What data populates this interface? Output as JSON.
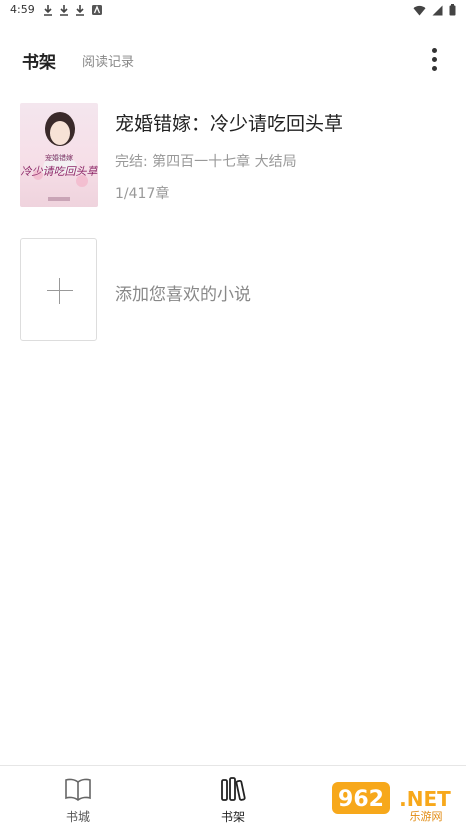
{
  "status_bar": {
    "time": "4:59"
  },
  "top_tabs": {
    "active": "书架",
    "inactive": "阅读记录"
  },
  "book": {
    "title": "宠婚错嫁：冷少请吃回头草",
    "status": "完结: 第四百一十七章  大结局",
    "progress": "1/417章",
    "cover_text": "冷少请吃回头草",
    "cover_subtitle": "宠婚错嫁"
  },
  "add_book": {
    "label": "添加您喜欢的小说"
  },
  "bottom_nav": {
    "items": [
      {
        "label": "书城",
        "icon": "open-book-icon"
      },
      {
        "label": "书架",
        "icon": "bookshelf-icon"
      }
    ]
  },
  "watermark": {
    "text": "962.NET",
    "subtext": "乐游网"
  },
  "colors": {
    "accent": "#222222",
    "muted": "#999999",
    "divider": "#e6e6e6"
  }
}
